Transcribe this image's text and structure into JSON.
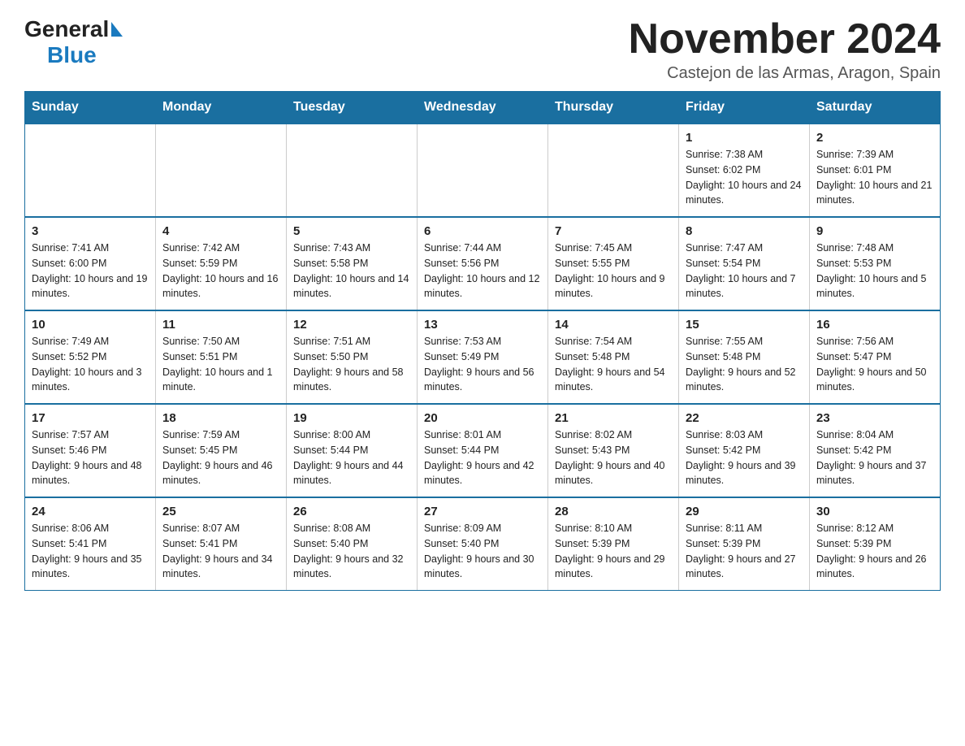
{
  "header": {
    "logo_general": "General",
    "logo_blue": "Blue",
    "month_title": "November 2024",
    "location": "Castejon de las Armas, Aragon, Spain"
  },
  "days_of_week": [
    "Sunday",
    "Monday",
    "Tuesday",
    "Wednesday",
    "Thursday",
    "Friday",
    "Saturday"
  ],
  "weeks": [
    [
      {
        "day": "",
        "info": ""
      },
      {
        "day": "",
        "info": ""
      },
      {
        "day": "",
        "info": ""
      },
      {
        "day": "",
        "info": ""
      },
      {
        "day": "",
        "info": ""
      },
      {
        "day": "1",
        "info": "Sunrise: 7:38 AM\nSunset: 6:02 PM\nDaylight: 10 hours and 24 minutes."
      },
      {
        "day": "2",
        "info": "Sunrise: 7:39 AM\nSunset: 6:01 PM\nDaylight: 10 hours and 21 minutes."
      }
    ],
    [
      {
        "day": "3",
        "info": "Sunrise: 7:41 AM\nSunset: 6:00 PM\nDaylight: 10 hours and 19 minutes."
      },
      {
        "day": "4",
        "info": "Sunrise: 7:42 AM\nSunset: 5:59 PM\nDaylight: 10 hours and 16 minutes."
      },
      {
        "day": "5",
        "info": "Sunrise: 7:43 AM\nSunset: 5:58 PM\nDaylight: 10 hours and 14 minutes."
      },
      {
        "day": "6",
        "info": "Sunrise: 7:44 AM\nSunset: 5:56 PM\nDaylight: 10 hours and 12 minutes."
      },
      {
        "day": "7",
        "info": "Sunrise: 7:45 AM\nSunset: 5:55 PM\nDaylight: 10 hours and 9 minutes."
      },
      {
        "day": "8",
        "info": "Sunrise: 7:47 AM\nSunset: 5:54 PM\nDaylight: 10 hours and 7 minutes."
      },
      {
        "day": "9",
        "info": "Sunrise: 7:48 AM\nSunset: 5:53 PM\nDaylight: 10 hours and 5 minutes."
      }
    ],
    [
      {
        "day": "10",
        "info": "Sunrise: 7:49 AM\nSunset: 5:52 PM\nDaylight: 10 hours and 3 minutes."
      },
      {
        "day": "11",
        "info": "Sunrise: 7:50 AM\nSunset: 5:51 PM\nDaylight: 10 hours and 1 minute."
      },
      {
        "day": "12",
        "info": "Sunrise: 7:51 AM\nSunset: 5:50 PM\nDaylight: 9 hours and 58 minutes."
      },
      {
        "day": "13",
        "info": "Sunrise: 7:53 AM\nSunset: 5:49 PM\nDaylight: 9 hours and 56 minutes."
      },
      {
        "day": "14",
        "info": "Sunrise: 7:54 AM\nSunset: 5:48 PM\nDaylight: 9 hours and 54 minutes."
      },
      {
        "day": "15",
        "info": "Sunrise: 7:55 AM\nSunset: 5:48 PM\nDaylight: 9 hours and 52 minutes."
      },
      {
        "day": "16",
        "info": "Sunrise: 7:56 AM\nSunset: 5:47 PM\nDaylight: 9 hours and 50 minutes."
      }
    ],
    [
      {
        "day": "17",
        "info": "Sunrise: 7:57 AM\nSunset: 5:46 PM\nDaylight: 9 hours and 48 minutes."
      },
      {
        "day": "18",
        "info": "Sunrise: 7:59 AM\nSunset: 5:45 PM\nDaylight: 9 hours and 46 minutes."
      },
      {
        "day": "19",
        "info": "Sunrise: 8:00 AM\nSunset: 5:44 PM\nDaylight: 9 hours and 44 minutes."
      },
      {
        "day": "20",
        "info": "Sunrise: 8:01 AM\nSunset: 5:44 PM\nDaylight: 9 hours and 42 minutes."
      },
      {
        "day": "21",
        "info": "Sunrise: 8:02 AM\nSunset: 5:43 PM\nDaylight: 9 hours and 40 minutes."
      },
      {
        "day": "22",
        "info": "Sunrise: 8:03 AM\nSunset: 5:42 PM\nDaylight: 9 hours and 39 minutes."
      },
      {
        "day": "23",
        "info": "Sunrise: 8:04 AM\nSunset: 5:42 PM\nDaylight: 9 hours and 37 minutes."
      }
    ],
    [
      {
        "day": "24",
        "info": "Sunrise: 8:06 AM\nSunset: 5:41 PM\nDaylight: 9 hours and 35 minutes."
      },
      {
        "day": "25",
        "info": "Sunrise: 8:07 AM\nSunset: 5:41 PM\nDaylight: 9 hours and 34 minutes."
      },
      {
        "day": "26",
        "info": "Sunrise: 8:08 AM\nSunset: 5:40 PM\nDaylight: 9 hours and 32 minutes."
      },
      {
        "day": "27",
        "info": "Sunrise: 8:09 AM\nSunset: 5:40 PM\nDaylight: 9 hours and 30 minutes."
      },
      {
        "day": "28",
        "info": "Sunrise: 8:10 AM\nSunset: 5:39 PM\nDaylight: 9 hours and 29 minutes."
      },
      {
        "day": "29",
        "info": "Sunrise: 8:11 AM\nSunset: 5:39 PM\nDaylight: 9 hours and 27 minutes."
      },
      {
        "day": "30",
        "info": "Sunrise: 8:12 AM\nSunset: 5:39 PM\nDaylight: 9 hours and 26 minutes."
      }
    ]
  ]
}
